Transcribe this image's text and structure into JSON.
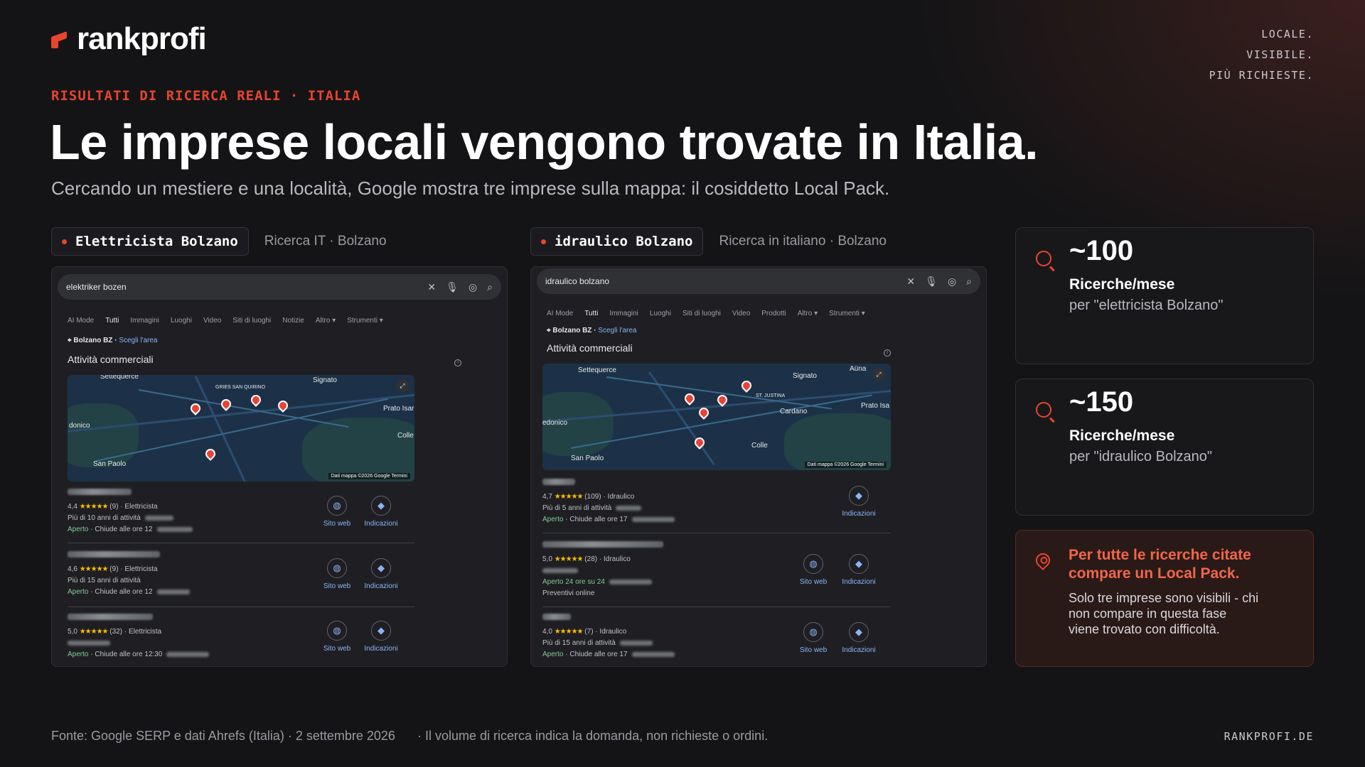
{
  "brand": {
    "name": "rankprofi",
    "accent": "#e8452c"
  },
  "tagline": [
    "LOCALE.",
    "VISIBILE.",
    "PIÙ RICHIESTE."
  ],
  "eyebrow": "RISULTATI DI RICERCA REALI · ITALIA",
  "headline": "Le imprese locali vengono trovate in Italia.",
  "subline": "Cercando un mestiere e una località, Google mostra tre imprese sulla mappa: il cosiddetto Local Pack.",
  "panels": [
    {
      "query": "Elettricista Bolzano",
      "meta": "Ricerca IT · Bolzano",
      "serp": {
        "search_value": "elektriker bozen",
        "tabs": [
          "AI Mode",
          "Tutti",
          "Immagini",
          "Luoghi",
          "Video",
          "Siti di luoghi",
          "Notizie",
          "Altro ▾",
          "Strumenti ▾"
        ],
        "active_tab": "Tutti",
        "location": "Bolzano BZ",
        "location_link": "Scegli l'area",
        "section_title": "Attività commerciali",
        "map_places": [
          "Settequerce",
          "Signato",
          "Prato Isar",
          "Colle",
          "San Paolo",
          "donico",
          "GRIES SAN QUIRINO"
        ],
        "map_credit": "Dati mappa ©2026 Google   Termini",
        "listings": [
          {
            "rating": "4,4",
            "stars": "★★★★★",
            "reviews": "(9)",
            "category": "Elettricista",
            "line2": "Più di 10 anni di attività",
            "open": "Aperto",
            "hours": "· Chiude alle ore 12",
            "actions": [
              "Sito web",
              "Indicazioni"
            ]
          },
          {
            "rating": "4,6",
            "stars": "★★★★★",
            "reviews": "(9)",
            "category": "Elettricista",
            "line2": "Più di 15 anni di attività",
            "open": "Aperto",
            "hours": "· Chiude alle ore 12",
            "actions": [
              "Sito web",
              "Indicazioni"
            ]
          },
          {
            "rating": "5,0",
            "stars": "★★★★★",
            "reviews": "(32)",
            "category": "Elettricista",
            "line2": "",
            "open": "Aperto",
            "hours": "· Chiude alle ore 12:30",
            "actions": [
              "Sito web",
              "Indicazioni"
            ]
          }
        ]
      }
    },
    {
      "query": "idraulico Bolzano",
      "meta": "Ricerca in italiano · Bolzano",
      "serp": {
        "search_value": "idraulico bolzano",
        "tabs": [
          "AI Mode",
          "Tutti",
          "Immagini",
          "Luoghi",
          "Siti di luoghi",
          "Video",
          "Prodotti",
          "Altro ▾",
          "Strumenti ▾"
        ],
        "active_tab": "Tutti",
        "location": "Bolzano BZ",
        "location_link": "Scegli l'area",
        "section_title": "Attività commerciali",
        "map_places": [
          "Settequerce",
          "Signato",
          "Aüna",
          "Prato Isa",
          "Cardano",
          "Colle",
          "San Paolo",
          "edonico",
          "ST. JUSTINA"
        ],
        "map_credit": "Dati mappa ©2026 Google   Termini",
        "listings": [
          {
            "rating": "4,7",
            "stars": "★★★★★",
            "reviews": "(109)",
            "category": "Idraulico",
            "line2": "Più di 5 anni di attività",
            "open": "Aperto",
            "hours": "· Chiude alle ore 17",
            "line4": "",
            "actions": [
              "Indicazioni"
            ]
          },
          {
            "rating": "5,0",
            "stars": "★★★★★",
            "reviews": "(28)",
            "category": "Idraulico",
            "line2": "",
            "open": "Aperto 24 ore su 24",
            "hours": "",
            "line4": "Preventivi online",
            "actions": [
              "Sito web",
              "Indicazioni"
            ]
          },
          {
            "rating": "4,0",
            "stars": "★★★★★",
            "reviews": "(7)",
            "category": "Idraulico",
            "line2": "Più di 15 anni di attività",
            "open": "Aperto",
            "hours": "· Chiude alle ore 17",
            "line4": "",
            "actions": [
              "Sito web",
              "Indicazioni"
            ]
          }
        ]
      }
    }
  ],
  "stats": [
    {
      "value": "~100",
      "label": "Ricerche/mese",
      "sub": "per \"elettricista Bolzano\""
    },
    {
      "value": "~150",
      "label": "Ricerche/mese",
      "sub": "per \"idraulico Bolzano\""
    }
  ],
  "callout": {
    "title": "Per tutte le ricerche citate compare un Local Pack.",
    "body": "Solo tre imprese sono visibili - chi non compare in questa fase viene trovato con difficoltà."
  },
  "footer": {
    "source": "Fonte: Google SERP e dati Ahrefs (Italia) · 2 settembre 2026",
    "note": "· Il volume di ricerca indica la domanda, non richieste o ordini.",
    "site": "RANKPROFI.DE"
  }
}
